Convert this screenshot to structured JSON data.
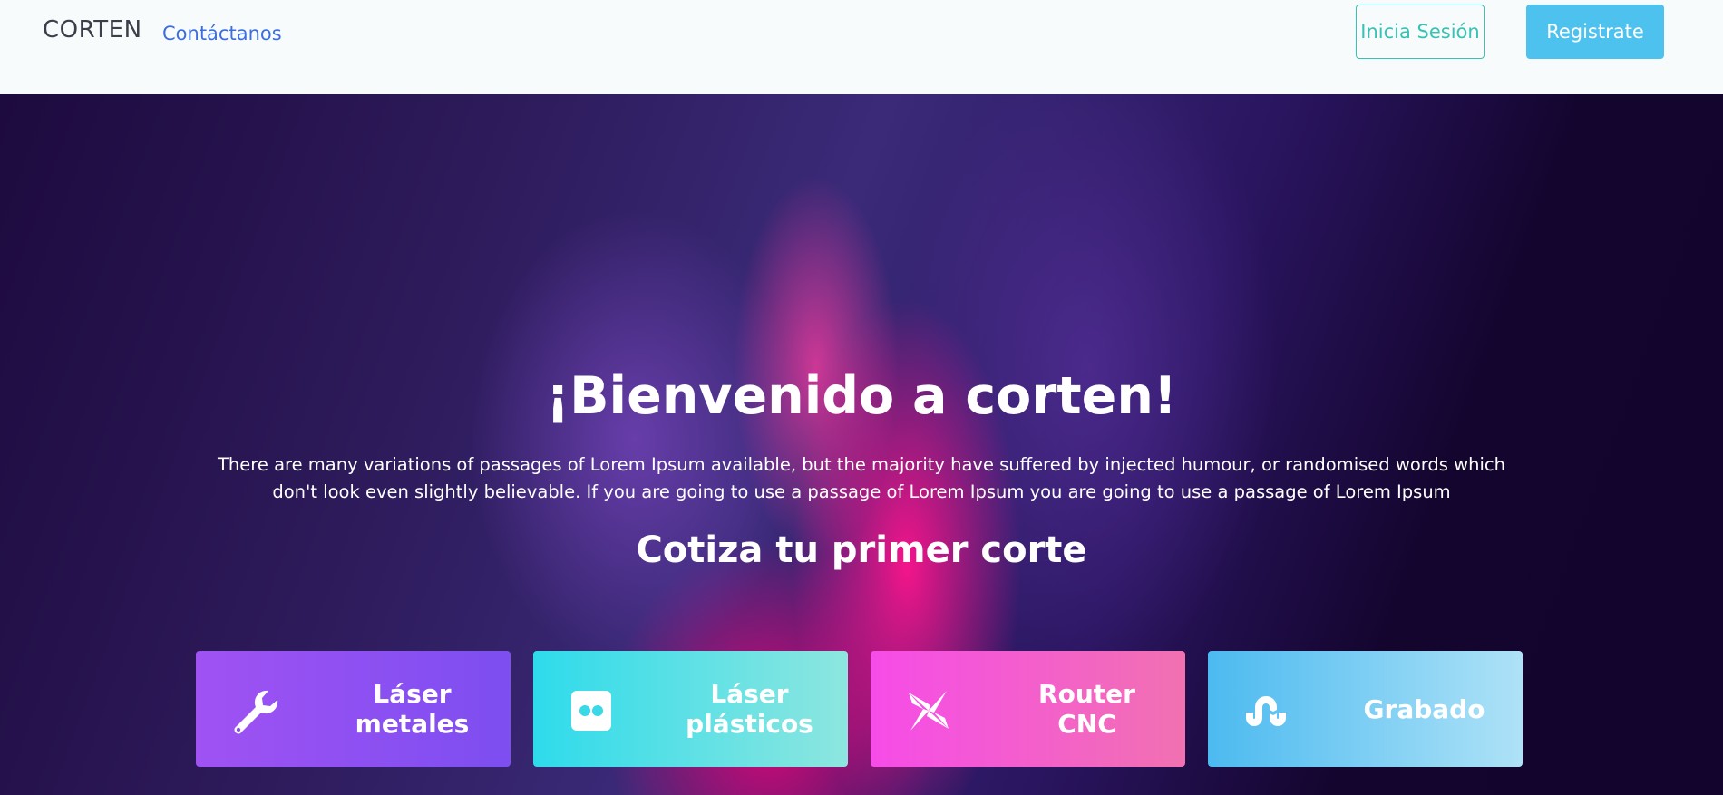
{
  "navbar": {
    "brand": "CORTEN",
    "contact_link": "Contáctanos",
    "login_button": "Inicia Sesión",
    "register_button": "Registrate"
  },
  "hero": {
    "title": "¡Bienvenido a corten!",
    "description": "There are many variations of passages of Lorem Ipsum available, but the majority have suffered by injected humour, or randomised words which don't look even slightly believable. If you are going to use a passage of Lorem Ipsum you are going to use a passage of Lorem Ipsum",
    "subtitle": "Cotiza tu primer corte"
  },
  "services": [
    {
      "label": "Láser metales",
      "icon": "wrench-icon",
      "color_start": "#a052f3",
      "color_end": "#7d4ef0"
    },
    {
      "label": "Láser plásticos",
      "icon": "flickr-icon",
      "color_start": "#2edbeb",
      "color_end": "#8de6df"
    },
    {
      "label": "Router CNC",
      "icon": "pinwheel-icon",
      "color_start": "#f64ce8",
      "color_end": "#f171b1"
    },
    {
      "label": "Grabado",
      "icon": "stumbleupon-icon",
      "color_start": "#4cbaf0",
      "color_end": "#aee2f7"
    }
  ],
  "colors": {
    "nav_background": "#f8fbfb",
    "link": "#3d6ee0",
    "login_outline": "#37c2b4",
    "register_fill": "#4ec2ee",
    "hero_dark": "#160636",
    "hero_pink": "#ff148c"
  }
}
